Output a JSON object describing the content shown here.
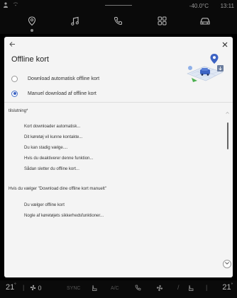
{
  "status_bar": {
    "temperature": "-40.0°C",
    "time": "13:11"
  },
  "top_nav": {
    "items": [
      {
        "icon": "navigation-pin-icon",
        "active": true
      },
      {
        "icon": "music-note-icon",
        "active": false
      },
      {
        "icon": "phone-icon",
        "active": false
      },
      {
        "icon": "apps-grid-icon",
        "active": false
      },
      {
        "icon": "car-icon",
        "active": false
      }
    ]
  },
  "dialog": {
    "title": "Offline kort",
    "options": [
      {
        "label": "Download automatisk offline kort",
        "checked": false
      },
      {
        "label": "Manuel download af offline kort",
        "checked": true
      }
    ],
    "section1_label": "tilslutning*",
    "section1_items": [
      "Kort downloader automatisk...",
      "Dit køretøj vil kunne kontakte...",
      "Du kan stadig vælge....",
      "Hvis du deaktiverer denne funktion...",
      "Sådan sletter du offline kort..."
    ],
    "section2_label": "Hvis du vælger \"Download dine offline kort manuelt\"",
    "section2_items": [
      "Du vælger offline kort",
      "Nogle af køretøjets sikkerhedsfunktioner..."
    ]
  },
  "bottom_bar": {
    "temp_left": "21",
    "temp_left_unit": "°",
    "fan_level": "0",
    "sync_label": "SYNC",
    "ac_label": "A/C",
    "temp_right": "21",
    "temp_right_unit": "°"
  },
  "colors": {
    "accent": "#3d63c3",
    "dialog_bg": "#f4f4f4",
    "chrome_bg": "#0a0a0a"
  }
}
